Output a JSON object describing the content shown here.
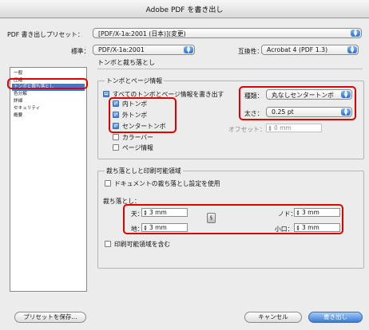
{
  "window": {
    "title": "Adobe PDF を書き出し"
  },
  "top": {
    "preset_label": "PDF 書き出しプリセット：",
    "preset_value": "[PDF/X-1a:2001 (日本)](変更)",
    "standard_label": "標準：",
    "standard_value": "PDF/X-1a:2001",
    "compat_label": "互換性：",
    "compat_value": "Acrobat 4 (PDF 1.3)"
  },
  "sidebar": {
    "items": [
      {
        "label": "一般"
      },
      {
        "label": "圧縮"
      },
      {
        "label": "トンボと裁ち落とし",
        "selected": true
      },
      {
        "label": "色分解"
      },
      {
        "label": "詳細"
      },
      {
        "label": "セキュリティ"
      },
      {
        "label": "概要"
      }
    ]
  },
  "panel": {
    "heading": "トンボと裁ち落とし",
    "marks": {
      "group_title": "トンボとページ情報",
      "all_label": "すべてのトンボとページ情報を書き出す",
      "crop_label": "内トンボ",
      "bleed_label": "外トンボ",
      "reg_label": "センタートンボ",
      "color_bar_label": "カラーバー",
      "page_info_label": "ページ情報",
      "type_label": "種類：",
      "type_value": "丸なしセンタートンボ",
      "weight_label": "太さ：",
      "weight_value": "0.25 pt",
      "offset_label": "オフセット：",
      "offset_value": "0 mm"
    },
    "bleed": {
      "group_title": "裁ち落としと印刷可能領域",
      "use_doc_label": "ドキュメントの裁ち落とし設定を使用",
      "bleed_label": "裁ち落とし：",
      "top_label": "天：",
      "top_value": "3 mm",
      "bottom_label": "地：",
      "bottom_value": "3 mm",
      "inside_label": "ノド：",
      "inside_value": "3 mm",
      "outside_label": "小口：",
      "outside_value": "3 mm",
      "slug_label": "印刷可能領域を含む"
    }
  },
  "buttons": {
    "save_preset": "プリセットを保存...",
    "cancel": "キャンセル",
    "export": "書き出し"
  },
  "colors": {
    "accent": "#3c78d8",
    "highlight": "#e00000"
  }
}
